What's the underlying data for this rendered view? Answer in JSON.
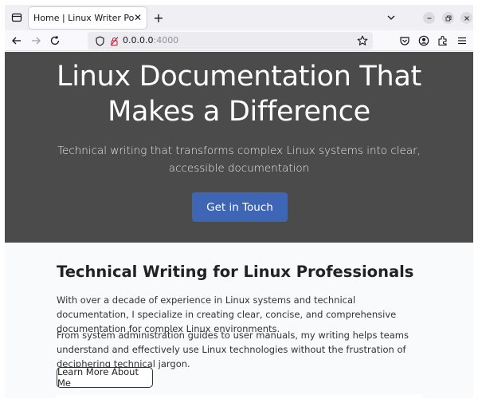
{
  "browser": {
    "tab_title": "Home | Linux Writer Portfolio",
    "url_host": "0.0.0.0",
    "url_port": ":4000"
  },
  "hero": {
    "title_line1": "Linux Documentation That",
    "title_line2": "Makes a Difference",
    "subtitle": "Technical writing that transforms complex Linux systems into clear, accessible documentation",
    "cta_label": "Get in Touch"
  },
  "intro": {
    "heading": "Technical Writing for Linux Professionals",
    "paragraph1": "With over a decade of experience in Linux systems and technical documentation, I specialize in creating clear, concise, and comprehensive documentation for complex Linux environments.",
    "paragraph2": "From system administration guides to user manuals, my writing helps teams understand and effectively use Linux technologies without the frustration of deciphering technical jargon.",
    "button_label": "Learn More About Me"
  },
  "colors": {
    "hero_bg": "#4b4b4b",
    "accent": "#3f66b5"
  }
}
